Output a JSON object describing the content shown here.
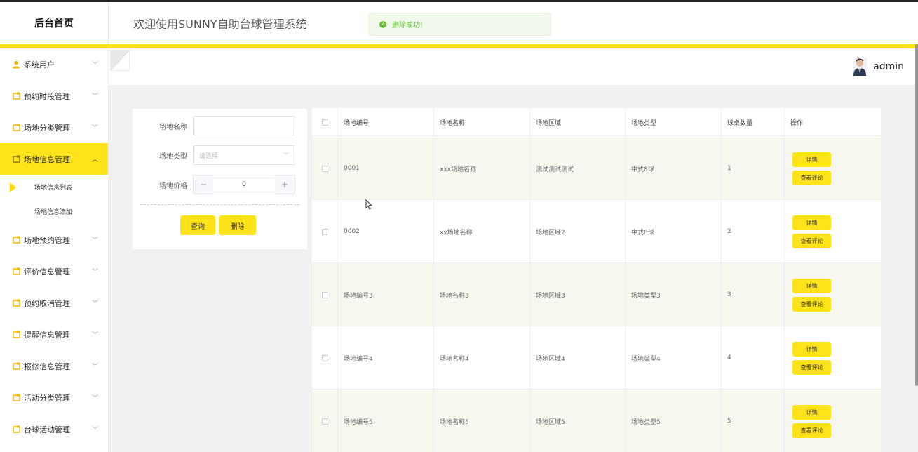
{
  "header": {
    "brand": "后台首页",
    "title": "欢迎使用SUNNY自助台球管理系统",
    "toast": "删除成功!"
  },
  "sidebar": {
    "items": [
      {
        "label": "系统用户",
        "icon": "user-icon"
      },
      {
        "label": "预约时段管理",
        "icon": "folder-icon"
      },
      {
        "label": "场地分类管理",
        "icon": "folder-icon"
      },
      {
        "label": "场地信息管理",
        "icon": "folder-icon",
        "active": true
      },
      {
        "label": "场地预约管理",
        "icon": "folder-icon"
      },
      {
        "label": "评价信息管理",
        "icon": "folder-icon"
      },
      {
        "label": "预约取消管理",
        "icon": "folder-icon"
      },
      {
        "label": "提醒信息管理",
        "icon": "folder-icon"
      },
      {
        "label": "报修信息管理",
        "icon": "folder-icon"
      },
      {
        "label": "活动分类管理",
        "icon": "folder-icon"
      },
      {
        "label": "台球活动管理",
        "icon": "folder-icon"
      }
    ],
    "subitems": [
      "场地信息列表",
      "场地信息添加"
    ]
  },
  "user": {
    "name": "admin"
  },
  "filter": {
    "name_label": "场地名称",
    "name_value": "",
    "type_label": "场地类型",
    "type_placeholder": "请选择",
    "price_label": "场地价格",
    "price_value": "0",
    "minus": "−",
    "plus": "+",
    "query_button": "查询",
    "delete_button": "删除"
  },
  "table": {
    "columns": [
      "场地编号",
      "场地名称",
      "场地区域",
      "场地类型",
      "球桌数量",
      "操作"
    ],
    "rows": [
      [
        "0001",
        "xxx场地名称",
        "测试测试测试",
        "中式8球",
        "1"
      ],
      [
        "0002",
        "xx场地名称",
        "场地区域2",
        "中式8球",
        "2"
      ],
      [
        "场地编号3",
        "场地名称3",
        "场地区域3",
        "场地类型3",
        "3"
      ],
      [
        "场地编号4",
        "场地名称4",
        "场地区域4",
        "场地类型4",
        "4"
      ],
      [
        "场地编号5",
        "场地名称5",
        "场地区域5",
        "场地类型5",
        "5"
      ]
    ],
    "detail_label": "详情",
    "review_label": "查看评论"
  },
  "colors": {
    "accent": "#ffe31a",
    "success": "#67c23a"
  }
}
